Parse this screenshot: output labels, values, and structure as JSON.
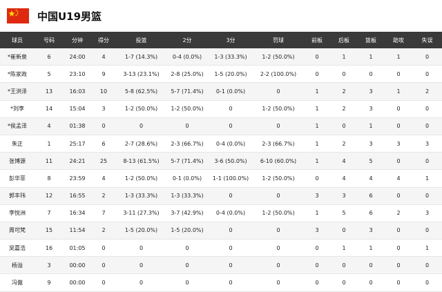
{
  "header": {
    "title": "中国U19男篮",
    "flag_color": "#de2910",
    "star_color": "#ffde00"
  },
  "table": {
    "columns": [
      "球员",
      "号码",
      "分钟",
      "得分",
      "投篮",
      "2分",
      "3分",
      "罚球",
      "前板",
      "后板",
      "篮板",
      "助攻",
      "失误"
    ],
    "rows": [
      [
        "*崔新泉",
        "6",
        "24:00",
        "4",
        "1-7 (14.3%)",
        "0-4 (0.0%)",
        "1-3 (33.3%)",
        "1-2 (50.0%)",
        "0",
        "1",
        "1",
        "1",
        "0"
      ],
      [
        "*陈家政",
        "5",
        "23:10",
        "9",
        "3-13 (23.1%)",
        "2-8 (25.0%)",
        "1-5 (20.0%)",
        "2-2 (100.0%)",
        "0",
        "0",
        "0",
        "0",
        "0"
      ],
      [
        "*王洪泽",
        "13",
        "16:03",
        "10",
        "5-8 (62.5%)",
        "5-7 (71.4%)",
        "0-1 (0.0%)",
        "0",
        "1",
        "2",
        "3",
        "1",
        "2"
      ],
      [
        "*刘李",
        "14",
        "15:04",
        "3",
        "1-2 (50.0%)",
        "1-2 (50.0%)",
        "0",
        "1-2 (50.0%)",
        "1",
        "2",
        "3",
        "0",
        "0"
      ],
      [
        "*侯孟泽",
        "4",
        "01:38",
        "0",
        "0",
        "0",
        "0",
        "0",
        "1",
        "0",
        "1",
        "0",
        "0"
      ],
      [
        "朱正",
        "1",
        "25:17",
        "6",
        "2-7 (28.6%)",
        "2-3 (66.7%)",
        "0-4 (0.0%)",
        "2-3 (66.7%)",
        "1",
        "2",
        "3",
        "3",
        "3"
      ],
      [
        "张博源",
        "11",
        "24:21",
        "25",
        "8-13 (61.5%)",
        "5-7 (71.4%)",
        "3-6 (50.0%)",
        "6-10 (60.0%)",
        "1",
        "4",
        "5",
        "0",
        "0"
      ],
      [
        "彭华菲",
        "8",
        "23:59",
        "4",
        "1-2 (50.0%)",
        "0-1 (0.0%)",
        "1-1 (100.0%)",
        "1-2 (50.0%)",
        "0",
        "4",
        "4",
        "4",
        "1"
      ],
      [
        "郭丰玮",
        "12",
        "16:55",
        "2",
        "1-3 (33.3%)",
        "1-3 (33.3%)",
        "0",
        "0",
        "3",
        "3",
        "6",
        "0",
        "0"
      ],
      [
        "李悦洲",
        "7",
        "16:34",
        "7",
        "3-11 (27.3%)",
        "3-7 (42.9%)",
        "0-4 (0.0%)",
        "1-2 (50.0%)",
        "1",
        "5",
        "6",
        "2",
        "3"
      ],
      [
        "周可梵",
        "15",
        "11:54",
        "2",
        "1-5 (20.0%)",
        "1-5 (20.0%)",
        "0",
        "0",
        "3",
        "0",
        "3",
        "0",
        "0"
      ],
      [
        "吴嘉浩",
        "16",
        "01:05",
        "0",
        "0",
        "0",
        "0",
        "0",
        "0",
        "1",
        "1",
        "0",
        "1"
      ],
      [
        "杨溢",
        "3",
        "00:00",
        "0",
        "0",
        "0",
        "0",
        "0",
        "0",
        "0",
        "0",
        "0",
        "0"
      ],
      [
        "冯傲",
        "9",
        "00:00",
        "0",
        "0",
        "0",
        "0",
        "0",
        "0",
        "0",
        "0",
        "0",
        "0"
      ]
    ]
  }
}
